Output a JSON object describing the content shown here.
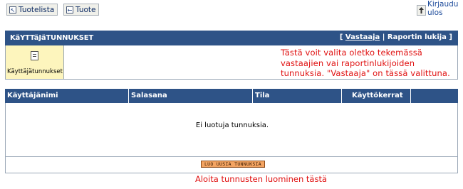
{
  "toolbar": {
    "productlist_label": "Tuotelista",
    "product_label": "Tuote",
    "logout_label_line1": "Kirjaudu",
    "logout_label_line2": "ulos"
  },
  "header": {
    "title": "KäYTTäJäTUNNUKSET",
    "link_open": "[ ",
    "respondent_link": "Vastaaja",
    "separator": " | ",
    "report_reader_link": "Raportin lukija",
    "link_close": " ]"
  },
  "tab": {
    "label": "Käyttäjätunnukset"
  },
  "annotation_top": "Tästä voit valita oletko tekemässä vastaajien vai raportinlukijoiden tunnuksia. \"Vastaaja\" on tässä valittuna.",
  "table": {
    "columns": [
      "Käyttäjänimi",
      "Salasana",
      "Tila",
      "Käyttökerrat"
    ],
    "empty_text": "Ei luotuja tunnuksia.",
    "create_button": "LUO UUSIA TUNNUKSIA"
  },
  "annotation_bottom": "Aloita tunnusten luominen tästä",
  "colors": {
    "header_bg": "#2e5387",
    "tab_bg": "#fdf5bd",
    "annotation": "#e01010",
    "button_bg": "#f4a462"
  }
}
